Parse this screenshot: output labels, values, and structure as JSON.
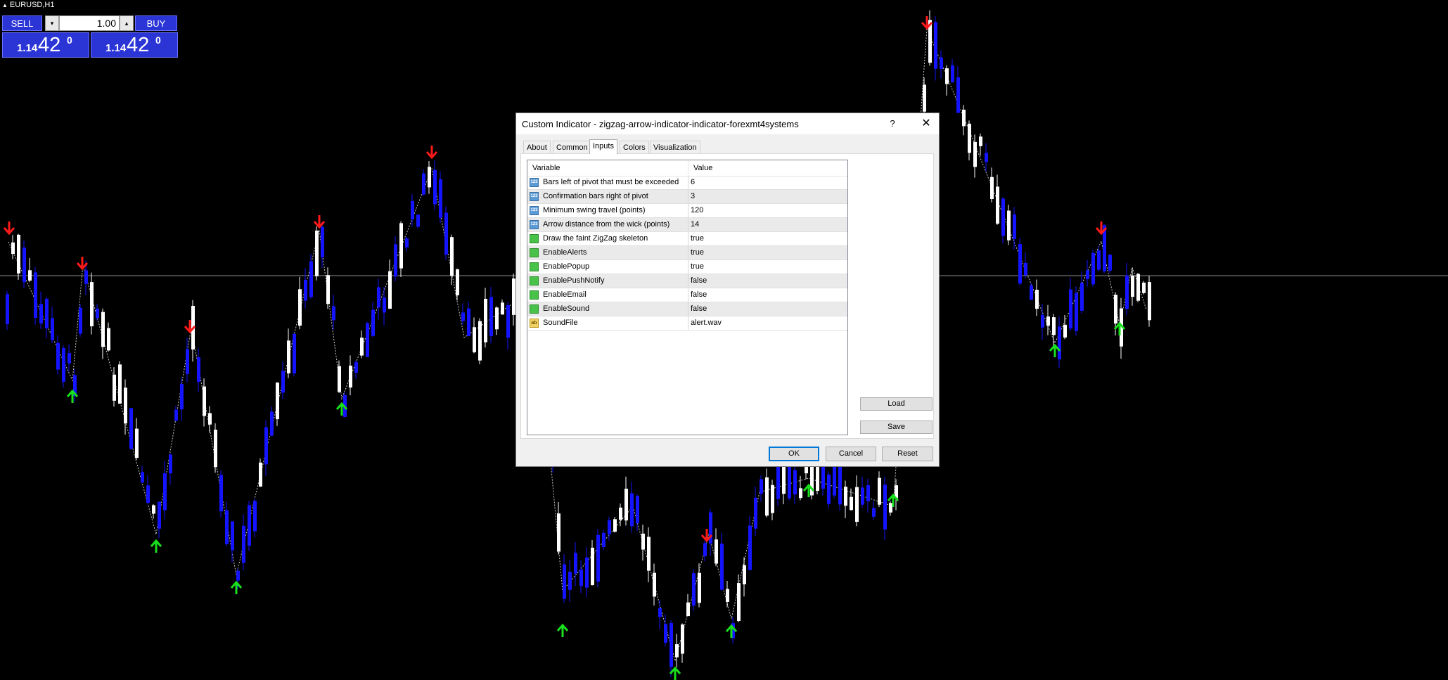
{
  "chart": {
    "symbol": "EURUSD,H1",
    "colors": {
      "background": "#000000",
      "bull": "#ffffff",
      "bear": "#1414ff",
      "up_arrow": "#18e01c",
      "down_arrow": "#ff1a1a",
      "zigzag": "#c8c8c8",
      "bid_line": "#8a8a8a"
    }
  },
  "trade_panel": {
    "sell_label": "SELL",
    "buy_label": "BUY",
    "lot_value": "1.00",
    "down_glyph": "▾",
    "up_glyph": "▴",
    "sell_price": {
      "prefix": "1.14",
      "big": "42",
      "sup": "0"
    },
    "buy_price": {
      "prefix": "1.14",
      "big": "42",
      "sup": "0"
    }
  },
  "dialog": {
    "title": "Custom Indicator - zigzag-arrow-indicator-indicator-forexmt4systems",
    "help_glyph": "?",
    "close_glyph": "✕",
    "tabs": [
      "About",
      "Common",
      "Inputs",
      "Colors",
      "Visualization"
    ],
    "active_tab": "Inputs",
    "table": {
      "headers": {
        "variable": "Variable",
        "value": "Value"
      },
      "rows": [
        {
          "type": "int",
          "variable": "Bars left of pivot that must be exceeded",
          "value": "6"
        },
        {
          "type": "int",
          "variable": "Confirmation bars right of pivot",
          "value": "3"
        },
        {
          "type": "int",
          "variable": "Minimum swing travel (points)",
          "value": "120"
        },
        {
          "type": "int",
          "variable": "Arrow distance from the wick (points)",
          "value": "14"
        },
        {
          "type": "bool",
          "variable": "Draw the faint ZigZag skeleton",
          "value": "true"
        },
        {
          "type": "bool",
          "variable": "EnableAlerts",
          "value": "true"
        },
        {
          "type": "bool",
          "variable": "EnablePopup",
          "value": "true"
        },
        {
          "type": "bool",
          "variable": "EnablePushNotify",
          "value": "false"
        },
        {
          "type": "bool",
          "variable": "EnableEmail",
          "value": "false"
        },
        {
          "type": "bool",
          "variable": "EnableSound",
          "value": "false"
        },
        {
          "type": "string",
          "variable": "SoundFile",
          "value": "alert.wav"
        }
      ]
    },
    "type_icons": {
      "int": "123",
      "bool": "",
      "string": "ab"
    },
    "buttons": {
      "load": "Load",
      "save": "Save",
      "ok": "OK",
      "cancel": "Cancel",
      "reset": "Reset"
    }
  }
}
